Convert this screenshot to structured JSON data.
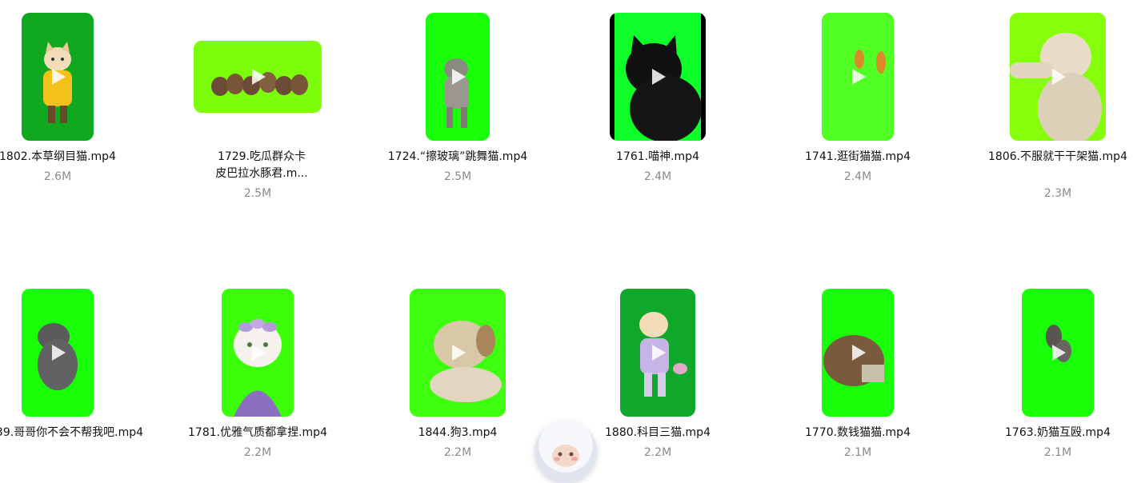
{
  "files": [
    {
      "name": "1802.本草纲目猫.mp4",
      "size": "2.6M",
      "bg": "#0fa81f",
      "subject": "cat-in-yellow-coat"
    },
    {
      "name": "1729.吃瓜群众卡皮巴拉水豚君.m...",
      "size": "2.5M",
      "bg": "#7bff0a",
      "subject": "capybara-group"
    },
    {
      "name": "1724.“擦玻璃”跳舞猫.mp4",
      "size": "2.5M",
      "bg": "#19ff0a",
      "subject": "dancing-cat"
    },
    {
      "name": "1761.喵神.mp4",
      "size": "2.4M",
      "bg": "#0fff2a",
      "subject": "black-cat"
    },
    {
      "name": "1741.逛街猫猫.mp4",
      "size": "2.4M",
      "bg": "#52ff22",
      "subject": "two-orange-cats"
    },
    {
      "name": "1806.不服就干干架猫.mp4",
      "size": "2.3M",
      "bg": "#86ff0a",
      "subject": "fighting-cat"
    },
    {
      "name": "39.哥哥你不会不帮我吧.mp4",
      "size": "",
      "bg": "#19ff0a",
      "subject": "gray-cat"
    },
    {
      "name": "1781.优雅气质都拿捏.mp4",
      "size": "2.2M",
      "bg": "#3cff0a",
      "subject": "cat-with-flower-crown"
    },
    {
      "name": "1844.狗3.mp4",
      "size": "2.2M",
      "bg": "#3fff10",
      "subject": "dog"
    },
    {
      "name": "1880.科目三猫.mp4",
      "size": "2.2M",
      "bg": "#0fa82a",
      "subject": "cat-in-purple-outfit"
    },
    {
      "name": "1770.数钱猫猫.mp4",
      "size": "2.1M",
      "bg": "#19ff0a",
      "subject": "cat-counting-money"
    },
    {
      "name": "1763.奶猫互殴.mp4",
      "size": "2.1M",
      "bg": "#19ff0a",
      "subject": "kittens-fighting"
    }
  ],
  "icons": {
    "play": "play-icon",
    "assistant": "assistant-avatar-icon"
  }
}
